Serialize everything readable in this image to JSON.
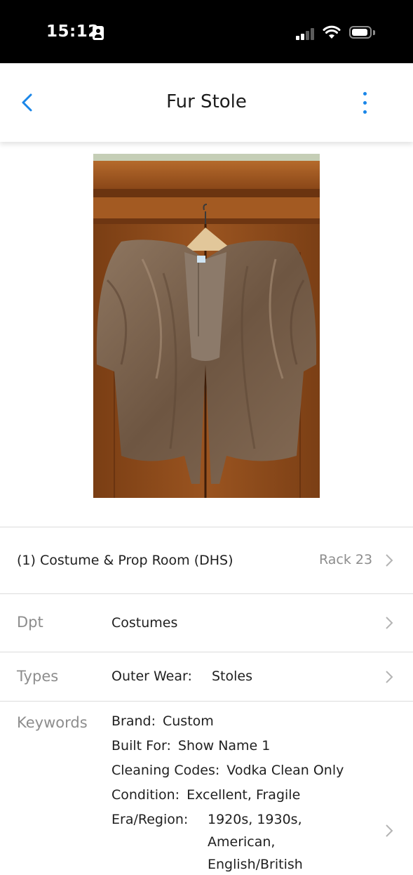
{
  "status_bar": {
    "time": "15:12"
  },
  "nav": {
    "title": "Fur Stole"
  },
  "location": {
    "text": "(1)  Costume & Prop Room (DHS)",
    "rack": "Rack 23"
  },
  "department": {
    "label": "Dpt",
    "value": "Costumes"
  },
  "types": {
    "label": "Types",
    "category": "Outer Wear:",
    "value": "Stoles"
  },
  "keywords": {
    "label": "Keywords",
    "items": [
      {
        "key": "Brand:",
        "value": "Custom"
      },
      {
        "key": "Built For:",
        "value": "Show Name 1"
      },
      {
        "key": "Cleaning Codes:",
        "value": "Vodka Clean Only"
      },
      {
        "key": "Condition:",
        "value": "Excellent, Fragile"
      },
      {
        "key": "Era/Region:",
        "value_lines": [
          "1920s, 1930s,",
          "American,",
          "English/British"
        ]
      }
    ]
  },
  "colors": {
    "accent": "#1a86e8",
    "divider": "#dcdcdc",
    "label_grey": "#8d8d8d"
  }
}
